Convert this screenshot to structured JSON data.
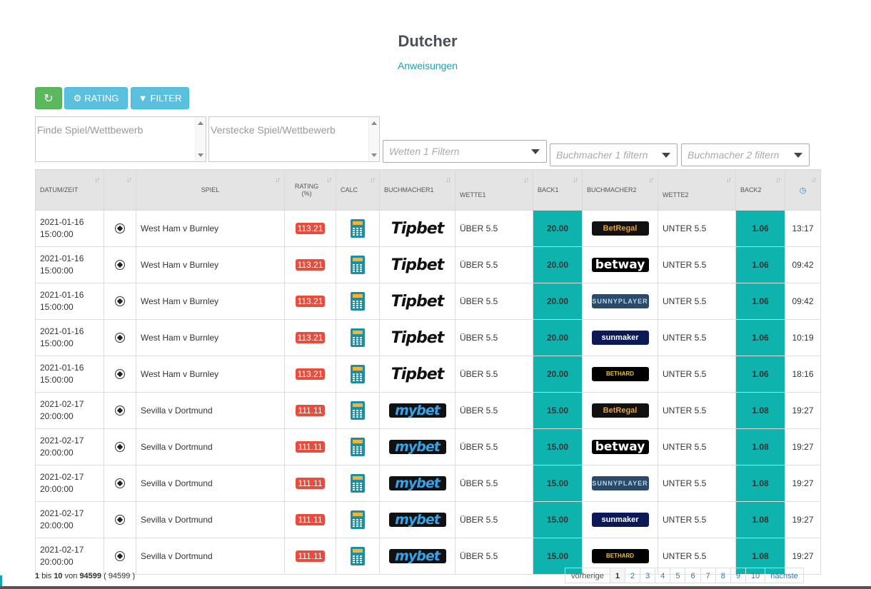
{
  "page": {
    "title": "Dutcher",
    "subtitle_link": "Anweisungen"
  },
  "toolbar": {
    "refresh_icon": "refresh-icon",
    "rating_label": "RATING",
    "filter_label": "FILTER"
  },
  "filters": {
    "find_placeholder": "Finde Spiel/Wettbewerb",
    "hide_placeholder": "Verstecke Spiel/Wettbewerb",
    "bets1_placeholder": "Wetten 1 Filtern",
    "bookmaker1_placeholder": "Buchmacher 1 filtern",
    "bookmaker2_placeholder": "Buchmacher 2 filtern"
  },
  "table": {
    "headers": {
      "date": "DATUM/ZEIT",
      "sport": "",
      "game": "SPIEL",
      "rating": "RATING (%)",
      "calc": "CALC",
      "bm1": "BUCHMACHER1",
      "bet1": "WETTE1",
      "back1": "BACK1",
      "bm2": "BUCHMACHER2",
      "bet2": "WETTE2",
      "back2": "BACK2"
    },
    "rows": [
      {
        "date": "2021-01-16",
        "time": "15:00:00",
        "game": "West Ham v Burnley",
        "rating": "113.21",
        "bm1": "Tipbet",
        "bet1": "ÜBER 5.5",
        "back1": "20.00",
        "bm2": "BetRegal",
        "bet2": "UNTER 5.5",
        "back2": "1.06",
        "updated": "13:17"
      },
      {
        "date": "2021-01-16",
        "time": "15:00:00",
        "game": "West Ham v Burnley",
        "rating": "113.21",
        "bm1": "Tipbet",
        "bet1": "ÜBER 5.5",
        "back1": "20.00",
        "bm2": "betway",
        "bet2": "UNTER 5.5",
        "back2": "1.06",
        "updated": "09:42"
      },
      {
        "date": "2021-01-16",
        "time": "15:00:00",
        "game": "West Ham v Burnley",
        "rating": "113.21",
        "bm1": "Tipbet",
        "bet1": "ÜBER 5.5",
        "back1": "20.00",
        "bm2": "SUNNYPLAYER",
        "bet2": "UNTER 5.5",
        "back2": "1.06",
        "updated": "09:42"
      },
      {
        "date": "2021-01-16",
        "time": "15:00:00",
        "game": "West Ham v Burnley",
        "rating": "113.21",
        "bm1": "Tipbet",
        "bet1": "ÜBER 5.5",
        "back1": "20.00",
        "bm2": "sunmaker",
        "bet2": "UNTER 5.5",
        "back2": "1.06",
        "updated": "10:19"
      },
      {
        "date": "2021-01-16",
        "time": "15:00:00",
        "game": "West Ham v Burnley",
        "rating": "113.21",
        "bm1": "Tipbet",
        "bet1": "ÜBER 5.5",
        "back1": "20.00",
        "bm2": "BETHARD",
        "bet2": "UNTER 5.5",
        "back2": "1.06",
        "updated": "18:16"
      },
      {
        "date": "2021-02-17",
        "time": "20:00:00",
        "game": "Sevilla v Dortmund",
        "rating": "111.11",
        "bm1": "mybet",
        "bet1": "ÜBER 5.5",
        "back1": "15.00",
        "bm2": "BetRegal",
        "bet2": "UNTER 5.5",
        "back2": "1.08",
        "updated": "19:27"
      },
      {
        "date": "2021-02-17",
        "time": "20:00:00",
        "game": "Sevilla v Dortmund",
        "rating": "111.11",
        "bm1": "mybet",
        "bet1": "ÜBER 5.5",
        "back1": "15.00",
        "bm2": "betway",
        "bet2": "UNTER 5.5",
        "back2": "1.08",
        "updated": "19:27"
      },
      {
        "date": "2021-02-17",
        "time": "20:00:00",
        "game": "Sevilla v Dortmund",
        "rating": "111.11",
        "bm1": "mybet",
        "bet1": "ÜBER 5.5",
        "back1": "15.00",
        "bm2": "SUNNYPLAYER",
        "bet2": "UNTER 5.5",
        "back2": "1.08",
        "updated": "19:27"
      },
      {
        "date": "2021-02-17",
        "time": "20:00:00",
        "game": "Sevilla v Dortmund",
        "rating": "111.11",
        "bm1": "mybet",
        "bet1": "ÜBER 5.5",
        "back1": "15.00",
        "bm2": "sunmaker",
        "bet2": "UNTER 5.5",
        "back2": "1.08",
        "updated": "19:27"
      },
      {
        "date": "2021-02-17",
        "time": "20:00:00",
        "game": "Sevilla v Dortmund",
        "rating": "111.11",
        "bm1": "mybet",
        "bet1": "ÜBER 5.5",
        "back1": "15.00",
        "bm2": "BETHARD",
        "bet2": "UNTER 5.5",
        "back2": "1.08",
        "updated": "19:27"
      }
    ]
  },
  "footer": {
    "from": "1",
    "bis": "bis",
    "to": "10",
    "von": "von",
    "total": "94599",
    "total_paren": "( 94599 )",
    "prev_label": "vorherige",
    "next_label": "nächste",
    "pages": [
      "1",
      "2",
      "3",
      "4",
      "5",
      "6",
      "7",
      "8",
      "9",
      "10"
    ],
    "current_page": "1"
  }
}
